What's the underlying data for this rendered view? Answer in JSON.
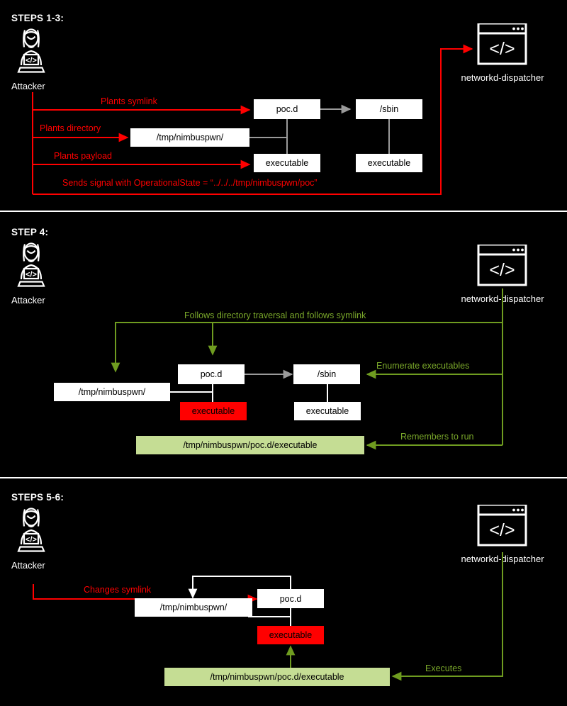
{
  "meta": {
    "colors": {
      "background": "#000000",
      "red": "#ff0000",
      "green_line": "#6f9c20",
      "green_text": "#7aa82a",
      "green_fill": "#c5dd94",
      "white": "#ffffff",
      "grey_line": "#9a9a9a"
    }
  },
  "panels": [
    {
      "id": "panel-steps-1-3",
      "title": "STEPS 1-3:",
      "actor": {
        "label": "Attacker",
        "icon": "attacker-person-laptop-icon"
      },
      "service": {
        "label": "networkd-dispatcher",
        "icon": "code-window-icon"
      },
      "boxes": [
        {
          "name": "poc-d",
          "label": "poc.d",
          "style": "white"
        },
        {
          "name": "sbin",
          "label": "/sbin",
          "style": "white"
        },
        {
          "name": "tmp-nimbuspwn",
          "label": "/tmp/nimbuspwn/",
          "style": "white"
        },
        {
          "name": "executable-left",
          "label": "executable",
          "style": "white"
        },
        {
          "name": "executable-right",
          "label": "executable",
          "style": "white"
        }
      ],
      "arrow_labels": [
        {
          "name": "plants-symlink",
          "text": "Plants symlink",
          "color": "red"
        },
        {
          "name": "plants-directory",
          "text": "Plants directory",
          "color": "red"
        },
        {
          "name": "plants-payload",
          "text": "Plants payload",
          "color": "red"
        },
        {
          "name": "sends-signal",
          "text": "Sends signal with OperationalState = “../../../tmp/nimbuspwn/poc”",
          "color": "red"
        }
      ]
    },
    {
      "id": "panel-step-4",
      "title": "STEP 4:",
      "actor": {
        "label": "Attacker",
        "icon": "attacker-person-laptop-icon"
      },
      "service": {
        "label": "networkd-dispatcher",
        "icon": "code-window-icon"
      },
      "boxes": [
        {
          "name": "poc-d",
          "label": "poc.d",
          "style": "white"
        },
        {
          "name": "sbin",
          "label": "/sbin",
          "style": "white"
        },
        {
          "name": "tmp-nimbuspwn",
          "label": "/tmp/nimbuspwn/",
          "style": "white"
        },
        {
          "name": "executable-payload",
          "label": "executable",
          "style": "red"
        },
        {
          "name": "executable-right",
          "label": "executable",
          "style": "white"
        },
        {
          "name": "resolved-path",
          "label": "/tmp/nimbuspwn/poc.d/executable",
          "style": "green"
        }
      ],
      "arrow_labels": [
        {
          "name": "follows-traversal",
          "text": "Follows directory traversal and follows symlink",
          "color": "green"
        },
        {
          "name": "enumerate-executables",
          "text": "Enumerate executables",
          "color": "green"
        },
        {
          "name": "remembers-to-run",
          "text": "Remembers to run",
          "color": "green"
        }
      ]
    },
    {
      "id": "panel-steps-5-6",
      "title": "STEPS 5-6:",
      "actor": {
        "label": "Attacker",
        "icon": "attacker-person-laptop-icon"
      },
      "service": {
        "label": "networkd-dispatcher",
        "icon": "code-window-icon"
      },
      "boxes": [
        {
          "name": "poc-d",
          "label": "poc.d",
          "style": "white"
        },
        {
          "name": "tmp-nimbuspwn",
          "label": "/tmp/nimbuspwn/",
          "style": "white"
        },
        {
          "name": "executable-payload",
          "label": "executable",
          "style": "red"
        },
        {
          "name": "resolved-path",
          "label": "/tmp/nimbuspwn/poc.d/executable",
          "style": "green"
        }
      ],
      "arrow_labels": [
        {
          "name": "changes-symlink",
          "text": "Changes symlink",
          "color": "red"
        },
        {
          "name": "executes",
          "text": "Executes",
          "color": "green"
        }
      ]
    }
  ]
}
